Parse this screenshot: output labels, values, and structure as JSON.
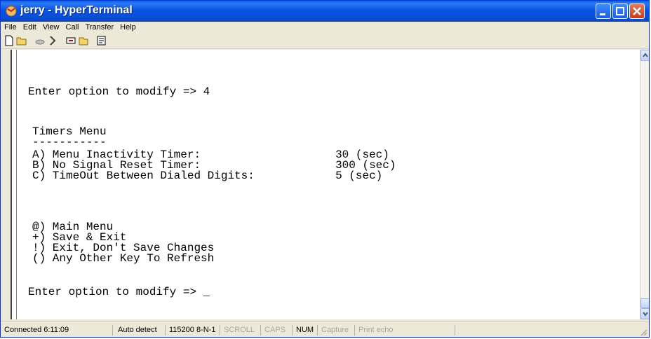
{
  "window": {
    "title": "jerry - HyperTerminal"
  },
  "menu": [
    "File",
    "Edit",
    "View",
    "Call",
    "Transfer",
    "Help"
  ],
  "toolbar_icons": [
    "new-icon",
    "open-icon",
    "call-icon",
    "disconnect-icon",
    "send-icon",
    "receive-icon",
    "properties-icon"
  ],
  "terminal": {
    "lines": [
      "Enter option to modify => 4",
      "Timers Menu",
      "-----------",
      "A) Menu Inactivity Timer:                    30 (sec)",
      "B) No Signal Reset Timer:                    300 (sec)",
      "C) TimeOut Between Dialed Digits:            5 (sec)",
      "@) Main Menu",
      "+) Save & Exit",
      "!) Exit, Don't Save Changes",
      "() Any Other Key To Refresh",
      "Enter option to modify => _"
    ]
  },
  "status": {
    "connected": "Connected 6:11:09",
    "detect": "Auto detect",
    "settings": "115200 8-N-1",
    "scroll": "SCROLL",
    "caps": "CAPS",
    "num": "NUM",
    "capture": "Capture",
    "printecho": "Print echo"
  }
}
